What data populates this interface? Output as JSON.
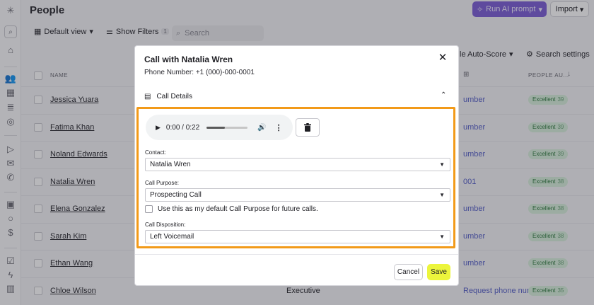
{
  "app": {
    "page_title": "People"
  },
  "header": {
    "ai_button_label": "Run AI prompt",
    "import_button_label": "Import"
  },
  "toolbar": {
    "view_label": "Default view",
    "filters_label": "Show Filters",
    "filters_count": "1",
    "search_placeholder": "Search",
    "auto_score_label": "le Auto-Score",
    "settings_label": "Search settings"
  },
  "table": {
    "col_name": "NAME",
    "col_people_score": "PEOPLE AU...",
    "rows": [
      {
        "name": "Jessica Yuara",
        "phone": "umber",
        "score_label": "Excellent",
        "score": "39"
      },
      {
        "name": "Fatima Khan",
        "phone": "umber",
        "score_label": "Excellent",
        "score": "39"
      },
      {
        "name": "Noland Edwards",
        "phone": "umber",
        "score_label": "Excellent",
        "score": "39"
      },
      {
        "name": "Natalia Wren",
        "phone": "001",
        "score_label": "Excellent",
        "score": "38"
      },
      {
        "name": "Elena Gonzalez",
        "phone": "umber",
        "score_label": "Excellent",
        "score": "38"
      },
      {
        "name": "Sarah Kim",
        "phone": "umber",
        "score_label": "Excellent",
        "score": "38"
      },
      {
        "name": "Ethan Wang",
        "phone": "umber",
        "score_label": "Excellent",
        "score": "38"
      },
      {
        "name": "Chloe Wilson",
        "phone": "Request phone number",
        "score_label": "Excellent",
        "score": "35"
      }
    ],
    "partial_role": "Executive"
  },
  "modal": {
    "title": "Call with Natalia Wren",
    "phone": "Phone Number: +1 (000)-000-0001",
    "section_title": "Call Details",
    "audio": {
      "time": "0:00 / 0:22",
      "progress": 0.45
    },
    "contact_label": "Contact:",
    "contact_value": "Natalia Wren",
    "purpose_label": "Call Purpose:",
    "purpose_value": "Prospecting Call",
    "default_checkbox_label": "Use this as my default Call Purpose for future calls.",
    "disposition_label": "Call Disposition:",
    "disposition_value": "Left Voicemail",
    "cancel_label": "Cancel",
    "save_label": "Save"
  },
  "colors": {
    "accent_purple": "#7d5fd6",
    "highlight_orange": "#f29a19",
    "save_yellow": "#ecf53c",
    "score_green": "#d8efdc"
  }
}
